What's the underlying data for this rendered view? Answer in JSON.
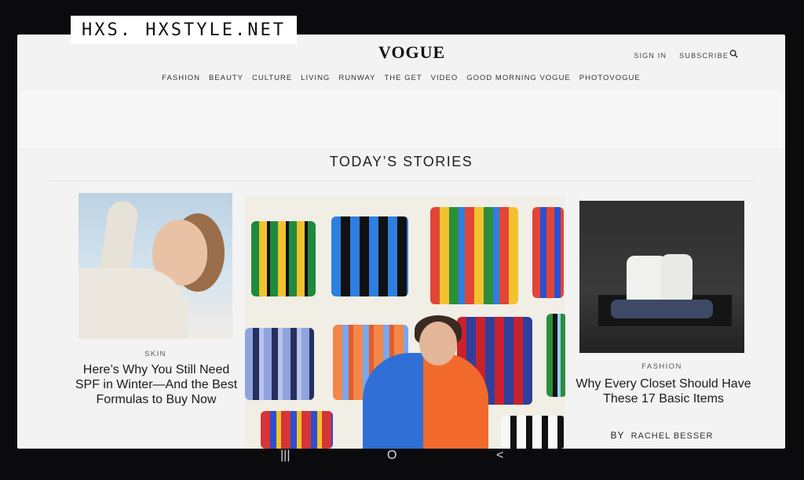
{
  "watermark": "HXS. HXSTYLE.NET",
  "masthead": {
    "logo": "VOGUE",
    "sign_in": "SIGN IN",
    "subscribe": "SUBSCRIBE",
    "search_icon": "search-icon"
  },
  "nav": {
    "items": [
      "FASHION",
      "BEAUTY",
      "CULTURE",
      "LIVING",
      "RUNWAY",
      "THE GET",
      "VIDEO",
      "GOOD MORNING VOGUE",
      "PHOTOVOGUE"
    ]
  },
  "section": {
    "title": "TODAY’S STORIES"
  },
  "cards": [
    {
      "kicker": "SKIN",
      "headline": "Here’s Why You Still Need SPF in Winter—And the Best Formulas to Buy Now"
    },
    {
      "kicker": "",
      "headline": ""
    },
    {
      "kicker": "FASHION",
      "headline": "Why Every Closet Should Have These 17 Basic Items",
      "by_label": "BY",
      "author": "RACHEL BESSER"
    }
  ],
  "system_nav": {
    "recent_icon": "recent-apps-icon",
    "home_icon": "home-icon",
    "back_icon": "back-icon",
    "recent_glyph": "|||",
    "home_glyph": "O",
    "back_glyph": "<"
  }
}
